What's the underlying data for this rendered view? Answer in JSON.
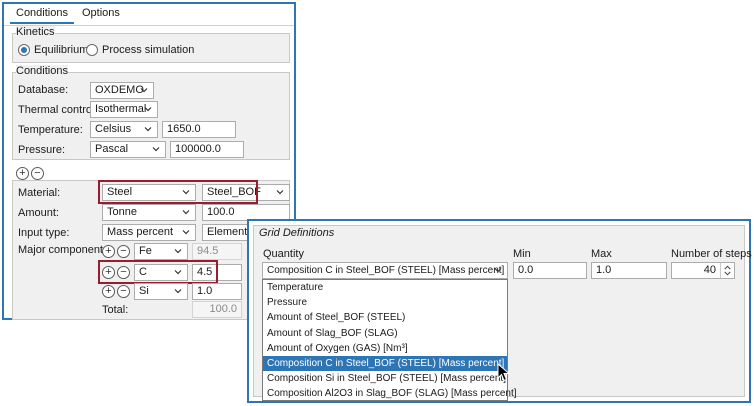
{
  "tabs": [
    {
      "label": "Conditions",
      "active": true
    },
    {
      "label": "Options",
      "active": false
    }
  ],
  "kinetics": {
    "title": "Kinetics",
    "options": [
      {
        "label": "Equilibrium",
        "checked": true
      },
      {
        "label": "Process simulation",
        "checked": false
      }
    ]
  },
  "conditions": {
    "title": "Conditions",
    "database": {
      "label": "Database:",
      "value": "OXDEMO"
    },
    "thermal_control": {
      "label": "Thermal control:",
      "value": "Isothermal"
    },
    "temperature": {
      "label": "Temperature:",
      "unit": "Celsius",
      "value": "1650.0"
    },
    "pressure": {
      "label": "Pressure:",
      "unit": "Pascal",
      "value": "100000.0"
    }
  },
  "material_section": {
    "material": {
      "label": "Material:",
      "value": "Steel",
      "name": "Steel_BOF"
    },
    "amount": {
      "label": "Amount:",
      "unit": "Tonne",
      "value": "100.0"
    },
    "input_type": {
      "label": "Input type:",
      "value": "Mass percent",
      "mode": "Element"
    },
    "major_component": {
      "label": "Major component:"
    },
    "components": [
      {
        "element": "Fe",
        "value": "94.5"
      },
      {
        "element": "C",
        "value": "4.5"
      },
      {
        "element": "Si",
        "value": "1.0"
      }
    ],
    "total": {
      "label": "Total:",
      "value": "100.0"
    }
  },
  "grid": {
    "title": "Grid Definitions",
    "headers": {
      "quantity": "Quantity",
      "min": "Min",
      "max": "Max",
      "steps": "Number of steps"
    },
    "quantity_value": "Composition C in Steel_BOF (STEEL) [Mass percent]",
    "min_value": "0.0",
    "max_value": "1.0",
    "steps_value": "40",
    "options": [
      "Temperature",
      "Pressure",
      "Amount of Steel_BOF (STEEL)",
      "Amount of Slag_BOF (SLAG)",
      "Amount of Oxygen (GAS) [Nm³]",
      "Composition C in Steel_BOF (STEEL) [Mass percent]",
      "Composition Si in Steel_BOF (STEEL) [Mass percent]",
      "Composition Al2O3 in Slag_BOF (SLAG) [Mass percent]"
    ],
    "selected_index": 5
  },
  "colors": {
    "accent": "#2e75b6",
    "highlight_box": "#9b1b30",
    "selected_row": "#2e75b6"
  }
}
